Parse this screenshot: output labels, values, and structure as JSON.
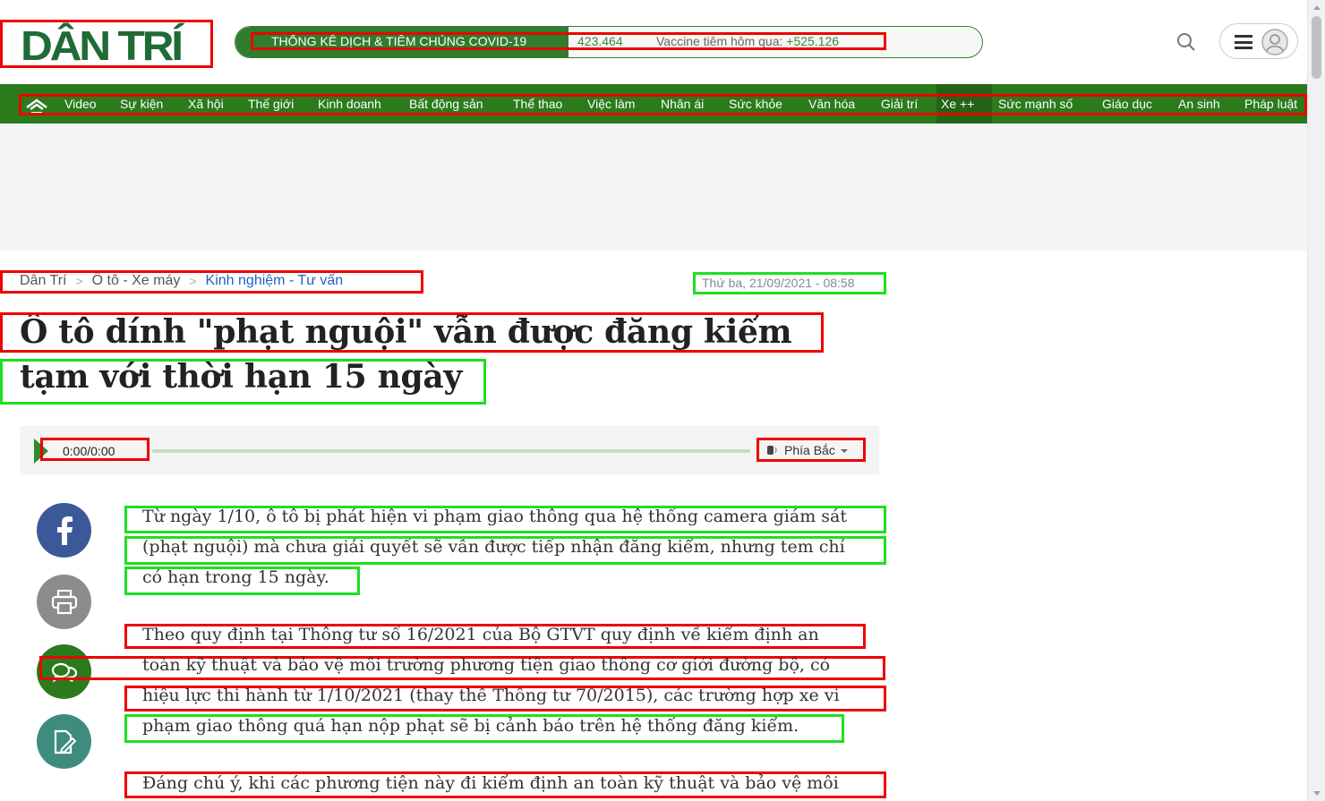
{
  "header": {
    "logo_text": "DÂN TRÍ",
    "covid": {
      "title": "THỐNG KÊ DỊCH & TIÊM CHỦNG COVID-19",
      "cases": "423.464",
      "vaccine_label": "Vaccine tiêm hôm qua:",
      "vaccine_value": "+525.126"
    }
  },
  "nav": {
    "items": [
      {
        "label": "Video"
      },
      {
        "label": "Sự kiện"
      },
      {
        "label": "Xã hội"
      },
      {
        "label": "Thế giới"
      },
      {
        "label": "Kinh doanh"
      },
      {
        "label": "Bất động sản"
      },
      {
        "label": "Thể thao"
      },
      {
        "label": "Việc làm"
      },
      {
        "label": "Nhân ái"
      },
      {
        "label": "Sức khỏe"
      },
      {
        "label": "Văn hóa"
      },
      {
        "label": "Giải trí"
      },
      {
        "label": "Xe ++"
      },
      {
        "label": "Sức mạnh số"
      },
      {
        "label": "Giáo dục"
      },
      {
        "label": "An sinh"
      },
      {
        "label": "Pháp luật"
      }
    ]
  },
  "breadcrumb": [
    "Dân Trí",
    "Ô tô - Xe máy",
    "Kinh nghiệm - Tư vấn"
  ],
  "article": {
    "date": "Thứ ba, 21/09/2021 - 08:58",
    "title_line1": "Ô tô dính \"phạt nguội\" vẫn được đăng kiểm",
    "title_line2": "tạm với thời hạn 15 ngày",
    "audio_time": "0:00/0:00",
    "audio_region": "Phía Bắc",
    "paragraphs": [
      [
        "Từ ngày 1/10, ô tô bị phát hiện vi phạm giao thông qua hệ thống camera giám sát",
        "(phạt nguội) mà chưa giải quyết sẽ vẫn được tiếp nhận đăng kiểm, nhưng tem chỉ",
        "có hạn trong 15 ngày."
      ],
      [
        "Theo quy định tại Thông tư số 16/2021 của Bộ GTVT quy định về kiểm định an",
        "toàn kỹ thuật và bảo vệ môi trường phương tiện giao thông cơ giới đường bộ, có",
        "hiệu lực thi hành từ 1/10/2021 (thay thế Thông tư 70/2015), các trường hợp xe vi",
        "phạm giao thông quá hạn nộp phạt sẽ bị cảnh báo trên hệ thống đăng kiểm."
      ],
      [
        "Đáng chú ý, khi các phương tiện này đi kiểm định an toàn kỹ thuật và bảo vệ môi"
      ]
    ]
  },
  "colors": {
    "brand_green": "#2b7b1c",
    "logo_green": "#1f6b35",
    "highlight_red": "#ee0000",
    "highlight_green": "#1ee01e"
  }
}
